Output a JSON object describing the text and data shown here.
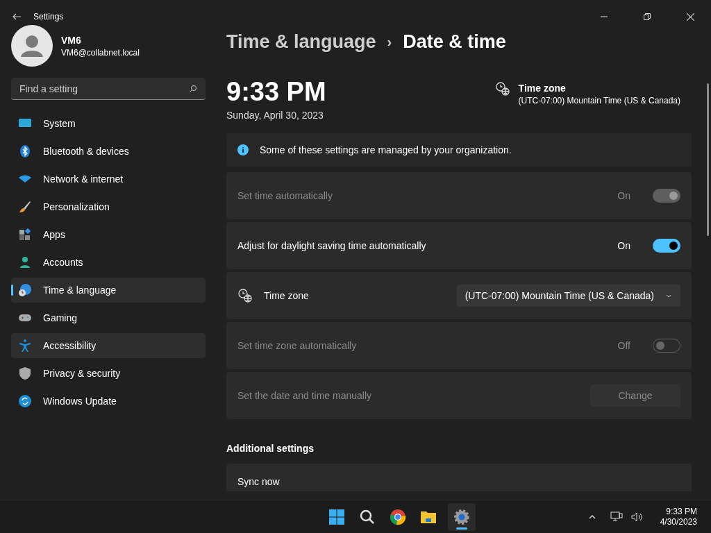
{
  "window": {
    "title": "Settings"
  },
  "user": {
    "name": "VM6",
    "email": "VM6@collabnet.local"
  },
  "search": {
    "placeholder": "Find a setting"
  },
  "sidebar": {
    "items": [
      {
        "label": "System",
        "selected": false,
        "hovered": false
      },
      {
        "label": "Bluetooth & devices",
        "selected": false,
        "hovered": false
      },
      {
        "label": "Network & internet",
        "selected": false,
        "hovered": false
      },
      {
        "label": "Personalization",
        "selected": false,
        "hovered": false
      },
      {
        "label": "Apps",
        "selected": false,
        "hovered": false
      },
      {
        "label": "Accounts",
        "selected": false,
        "hovered": false
      },
      {
        "label": "Time & language",
        "selected": true,
        "hovered": false
      },
      {
        "label": "Gaming",
        "selected": false,
        "hovered": false
      },
      {
        "label": "Accessibility",
        "selected": false,
        "hovered": true
      },
      {
        "label": "Privacy & security",
        "selected": false,
        "hovered": false
      },
      {
        "label": "Windows Update",
        "selected": false,
        "hovered": false
      }
    ]
  },
  "breadcrumb": {
    "parent": "Time & language",
    "separator": "›",
    "current": "Date & time"
  },
  "clock": {
    "time": "9:33 PM",
    "date": "Sunday, April 30, 2023"
  },
  "time_zone_summary": {
    "title": "Time zone",
    "value": "(UTC-07:00) Mountain Time (US & Canada)"
  },
  "notice": "Some of these settings are managed by your organization.",
  "rows": [
    {
      "kind": "toggle",
      "label": "Set time automatically",
      "disabled": true,
      "on": true,
      "state_text": "On"
    },
    {
      "kind": "toggle",
      "label": "Adjust for daylight saving time automatically",
      "disabled": false,
      "on": true,
      "state_text": "On"
    },
    {
      "kind": "dropdown",
      "label": "Time zone",
      "disabled": false,
      "value": "(UTC-07:00) Mountain Time (US & Canada)"
    },
    {
      "kind": "toggle",
      "label": "Set time zone automatically",
      "disabled": true,
      "on": false,
      "state_text": "Off"
    },
    {
      "kind": "button",
      "label": "Set the date and time manually",
      "disabled": true,
      "button": "Change"
    }
  ],
  "additional": {
    "heading": "Additional settings",
    "rows": [
      {
        "label": "Sync now"
      }
    ]
  },
  "taskbar": {
    "time": "9:33 PM",
    "date": "4/30/2023"
  }
}
